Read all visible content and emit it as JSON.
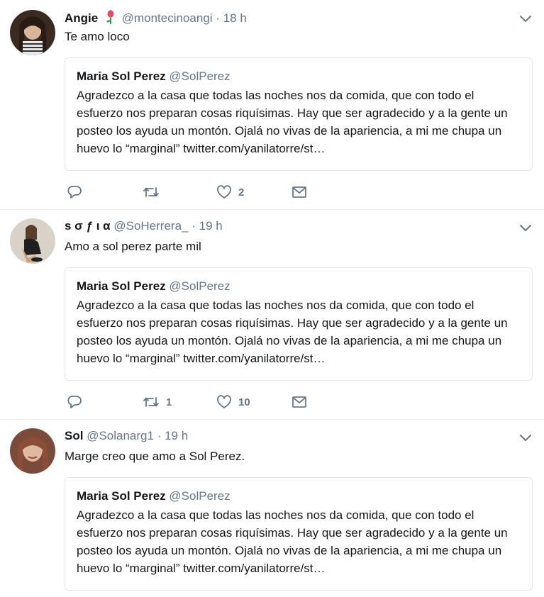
{
  "tweets": [
    {
      "name": "Angie",
      "emoji_icon": "rose-emoji-icon",
      "handle": "@montecinoangi",
      "time": "18 h",
      "text": "Te amo loco",
      "quote": {
        "name": "Maria Sol Perez",
        "handle": "@SolPerez",
        "body": "Agradezco a la casa que todas las noches nos da comida, que con todo el esfuerzo nos preparan cosas riquísimas. Hay que ser agradecido y a la gente un posteo los ayuda un montón. Ojalá no vivas de la apariencia, a mi me chupa un huevo lo “marginal” twitter.com/yanilatorre/st…"
      },
      "retweets": "",
      "likes": "2"
    },
    {
      "name": "ѕ σ ƒ ι α",
      "handle": "@SoHerrera_",
      "time": "19 h",
      "text": "Amo a sol perez parte mil",
      "quote": {
        "name": "Maria Sol Perez",
        "handle": "@SolPerez",
        "body": "Agradezco a la casa que todas las noches nos da comida, que con todo el esfuerzo nos preparan cosas riquísimas. Hay que ser agradecido y a la gente un posteo los ayuda un montón. Ojalá no vivas de la apariencia, a mi me chupa un huevo lo “marginal” twitter.com/yanilatorre/st…"
      },
      "retweets": "1",
      "likes": "10"
    },
    {
      "name": "Sol",
      "handle": "@Solanarg1",
      "time": "19 h",
      "text": "Marge creo que amo a Sol Perez.",
      "quote": {
        "name": "Maria Sol Perez",
        "handle": "@SolPerez",
        "body": "Agradezco a la casa que todas las noches nos da comida, que con todo el esfuerzo nos preparan cosas riquísimas. Hay que ser agradecido y a la gente un posteo los ayuda un montón. Ojalá no vivas de la apariencia, a mi me chupa un huevo lo “marginal” twitter.com/yanilatorre/st…"
      }
    }
  ],
  "separator": "·",
  "icons": {
    "reply": "reply-icon",
    "retweet": "retweet-icon",
    "like": "heart-icon",
    "dm": "envelope-icon",
    "caret": "chevron-down-icon"
  },
  "colors": {
    "text": "#14171a",
    "secondary": "#657786",
    "border": "#e6ecf0"
  }
}
